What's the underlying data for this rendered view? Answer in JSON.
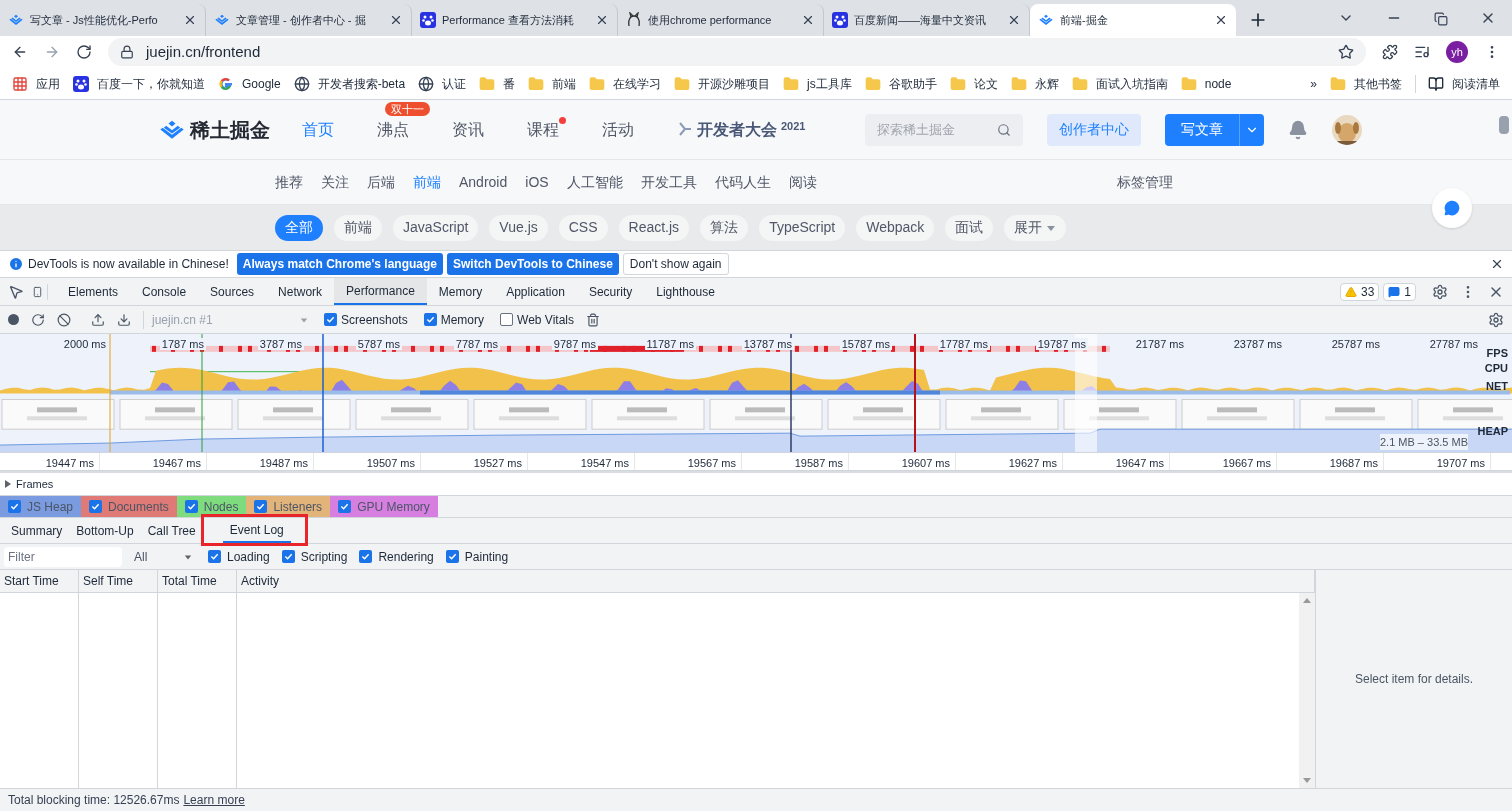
{
  "browser": {
    "tabs": [
      {
        "title": "写文章 - Js性能优化-Perfo",
        "kind": "juejin",
        "selected": false
      },
      {
        "title": "文章管理 - 创作者中心 - 掘",
        "kind": "juejin",
        "selected": false
      },
      {
        "title": "Performance 查看方法消耗",
        "kind": "baidu",
        "selected": false
      },
      {
        "title": "使用chrome performance",
        "kind": "cat",
        "selected": false
      },
      {
        "title": "百度新闻——海量中文资讯",
        "kind": "baidu",
        "selected": false
      },
      {
        "title": "前端-掘金",
        "kind": "juejin",
        "selected": true
      }
    ],
    "address": "juejin.cn/frontend",
    "profile": "yh",
    "bookmarks": [
      {
        "label": "应用",
        "kind": "apps"
      },
      {
        "label": "百度一下，你就知道",
        "kind": "baidu"
      },
      {
        "label": "Google",
        "kind": "google"
      },
      {
        "label": "开发者搜索-beta",
        "kind": "globe"
      },
      {
        "label": "认证",
        "kind": "globe"
      },
      {
        "label": "番",
        "kind": "folder"
      },
      {
        "label": "前端",
        "kind": "folder"
      },
      {
        "label": "在线学习",
        "kind": "folder"
      },
      {
        "label": "开源沙雕项目",
        "kind": "folder"
      },
      {
        "label": "js工具库",
        "kind": "folder"
      },
      {
        "label": "谷歌助手",
        "kind": "folder"
      },
      {
        "label": "论文",
        "kind": "folder"
      },
      {
        "label": "永辉",
        "kind": "folder"
      },
      {
        "label": "面试入坑指南",
        "kind": "folder"
      },
      {
        "label": "node",
        "kind": "folder"
      }
    ],
    "more": "»",
    "other_bookmarks": "其他书签",
    "reading_list": "阅读清单"
  },
  "site": {
    "logo": "稀土掘金",
    "nav": [
      {
        "label": "首页",
        "selected": true,
        "dot": false
      },
      {
        "label": "沸点",
        "selected": false,
        "dot": false,
        "badge": "双十一"
      },
      {
        "label": "资讯",
        "selected": false,
        "dot": false
      },
      {
        "label": "课程",
        "selected": false,
        "dot": true
      },
      {
        "label": "活动",
        "selected": false,
        "dot": false
      }
    ],
    "conference": {
      "label": "开发者大会",
      "year": "2021"
    },
    "search_placeholder": "探索稀土掘金",
    "creator_button": "创作者中心",
    "write_button": "写文章",
    "categories": [
      {
        "label": "推荐",
        "selected": false
      },
      {
        "label": "关注",
        "selected": false
      },
      {
        "label": "后端",
        "selected": false
      },
      {
        "label": "前端",
        "selected": true
      },
      {
        "label": "Android",
        "selected": false
      },
      {
        "label": "iOS",
        "selected": false
      },
      {
        "label": "人工智能",
        "selected": false
      },
      {
        "label": "开发工具",
        "selected": false
      },
      {
        "label": "代码人生",
        "selected": false
      },
      {
        "label": "阅读",
        "selected": false
      }
    ],
    "tag_manage": "标签管理",
    "tags": [
      {
        "label": "全部",
        "selected": true
      },
      {
        "label": "前端",
        "selected": false
      },
      {
        "label": "JavaScript",
        "selected": false
      },
      {
        "label": "Vue.js",
        "selected": false
      },
      {
        "label": "CSS",
        "selected": false
      },
      {
        "label": "React.js",
        "selected": false
      },
      {
        "label": "算法",
        "selected": false
      },
      {
        "label": "TypeScript",
        "selected": false
      },
      {
        "label": "Webpack",
        "selected": false
      },
      {
        "label": "面试",
        "selected": false
      }
    ],
    "expand": "展开"
  },
  "devtools": {
    "infobar": {
      "message": "DevTools is now available in Chinese!",
      "buttons": [
        {
          "label": "Always match Chrome's language",
          "kind": "primary"
        },
        {
          "label": "Switch DevTools to Chinese",
          "kind": "primary"
        },
        {
          "label": "Don't show again",
          "kind": "plain"
        }
      ]
    },
    "tabs": [
      {
        "label": "Elements",
        "selected": false
      },
      {
        "label": "Console",
        "selected": false
      },
      {
        "label": "Sources",
        "selected": false
      },
      {
        "label": "Network",
        "selected": false
      },
      {
        "label": "Performance",
        "selected": true
      },
      {
        "label": "Memory",
        "selected": false
      },
      {
        "label": "Application",
        "selected": false
      },
      {
        "label": "Security",
        "selected": false
      },
      {
        "label": "Lighthouse",
        "selected": false
      }
    ],
    "warnings": "33",
    "messages": "1",
    "profile_select": "juejin.cn #1",
    "options": [
      {
        "label": "Screenshots",
        "checked": true
      },
      {
        "label": "Memory",
        "checked": true
      },
      {
        "label": "Web Vitals",
        "checked": false
      }
    ],
    "overview": {
      "ticks": [
        "2000 ms",
        "1787 ms",
        "3787 ms",
        "5787 ms",
        "7787 ms",
        "9787 ms",
        "11787 ms",
        "13787 ms",
        "15787 ms",
        "17787 ms",
        "19787 ms",
        "21787 ms",
        "23787 ms",
        "25787 ms",
        "27787 ms"
      ],
      "tracks": [
        "FPS",
        "CPU",
        "NET",
        "HEAP"
      ],
      "heap_range": "2.1 MB – 33.5 MB"
    },
    "ruler": [
      "19447 ms",
      "19467 ms",
      "19487 ms",
      "19507 ms",
      "19527 ms",
      "19547 ms",
      "19567 ms",
      "19587 ms",
      "19607 ms",
      "19627 ms",
      "19647 ms",
      "19667 ms",
      "19687 ms",
      "19707 ms"
    ],
    "frames": "Frames",
    "counters": [
      {
        "label": "JS Heap",
        "checked": true,
        "color": "#7b9be0"
      },
      {
        "label": "Documents",
        "checked": true,
        "color": "#e07a76"
      },
      {
        "label": "Nodes",
        "checked": true,
        "color": "#7edc7e"
      },
      {
        "label": "Listeners",
        "checked": true,
        "color": "#e3b47a"
      },
      {
        "label": "GPU Memory",
        "checked": true,
        "color": "#d77fe0"
      }
    ],
    "subtabs": [
      {
        "label": "Summary",
        "selected": false
      },
      {
        "label": "Bottom-Up",
        "selected": false
      },
      {
        "label": "Call Tree",
        "selected": false
      },
      {
        "label": "Event Log",
        "selected": true
      }
    ],
    "filter_placeholder": "Filter",
    "category_select": "All",
    "categories": [
      {
        "label": "Loading",
        "checked": true
      },
      {
        "label": "Scripting",
        "checked": true
      },
      {
        "label": "Rendering",
        "checked": true
      },
      {
        "label": "Painting",
        "checked": true
      }
    ],
    "columns": [
      "Start Time",
      "Self Time",
      "Total Time",
      "Activity"
    ],
    "details": "Select item for details.",
    "status": {
      "text": "Total blocking time: 12526.67ms",
      "link": "Learn more"
    }
  }
}
